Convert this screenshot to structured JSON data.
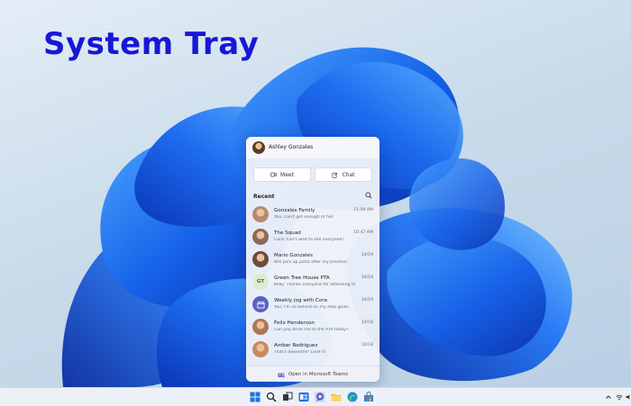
{
  "heading": "System Tray",
  "flyout": {
    "user_name": "Ashley Gonzales",
    "meet_label": "Meet",
    "chat_label": "Chat",
    "recent_label": "Recent",
    "footer_label": "Open in Microsoft Teams",
    "chats": [
      {
        "name": "Gonzales Family",
        "message": "You: Can't get enough of her.",
        "time": "11:09 AM",
        "avatar": "photo",
        "color": "#b98a6a"
      },
      {
        "name": "The Squad",
        "message": "Cora: Can't wait to see everyone!",
        "time": "10:47 AM",
        "avatar": "photo",
        "color": "#8c6a58"
      },
      {
        "name": "Mario Gonzales",
        "message": "Will pick up pizza after my practice.",
        "time": "10/19",
        "avatar": "photo",
        "color": "#6d4c3d"
      },
      {
        "name": "Green Tree House PTA",
        "message": "Kelly: Thanks everyone for attending today.",
        "time": "10/19",
        "avatar": "initials",
        "initials": "GT",
        "color": "#dfead3"
      },
      {
        "name": "Weekly jog with Cora",
        "message": "You: I'm so behind on my step goals.",
        "time": "10/19",
        "avatar": "calendar",
        "color": "#5b62c4"
      },
      {
        "name": "Felix Henderson",
        "message": "Can you drive me to the PTA today?",
        "time": "10/18",
        "avatar": "photo",
        "color": "#b07655"
      },
      {
        "name": "Amber Rodriguez",
        "message": "That's awesome! Love it!",
        "time": "10/18",
        "avatar": "photo",
        "color": "#c98a5a"
      }
    ]
  },
  "taskbar": {
    "icons": [
      "windows-start-icon",
      "search-icon",
      "task-view-icon",
      "widgets-icon",
      "chat-icon",
      "file-explorer-icon",
      "edge-icon",
      "store-icon"
    ],
    "tray_icons": [
      "chevron-up-icon",
      "wifi-icon",
      "volume-icon"
    ]
  },
  "colors": {
    "heading": "#1717d6",
    "accent": "#5b62c4",
    "bloom_dark": "#0b3fc8",
    "bloom_light": "#3b8df5"
  }
}
